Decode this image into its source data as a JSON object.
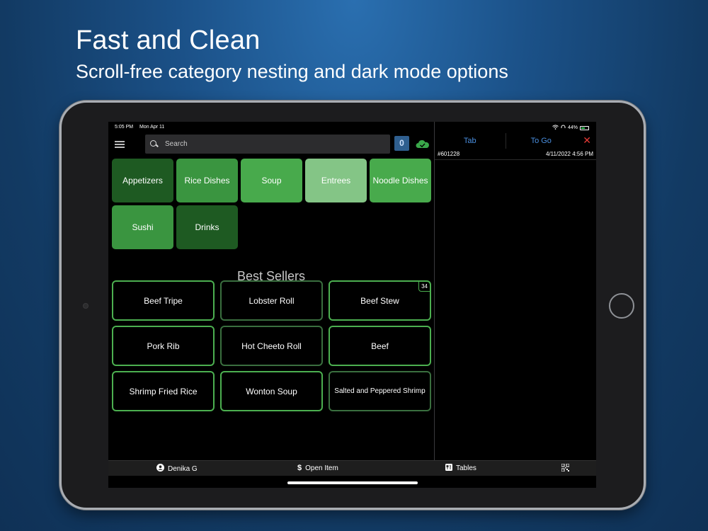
{
  "marketing": {
    "headline": "Fast and Clean",
    "subheadline": "Scroll-free category nesting and dark mode options"
  },
  "statusbar": {
    "time": "5:05 PM",
    "date": "Mon Apr 11",
    "battery": "44%"
  },
  "search": {
    "placeholder": "Search"
  },
  "cart_count": "0",
  "categories": [
    {
      "label": "Appetizers",
      "color": "#1e5a22"
    },
    {
      "label": "Rice Dishes",
      "color": "#3a9540"
    },
    {
      "label": "Soup",
      "color": "#48aa4c"
    },
    {
      "label": "Entrees",
      "color": "#84c586"
    },
    {
      "label": "Noodle Dishes",
      "color": "#48aa4c"
    },
    {
      "label": "Sushi",
      "color": "#3a9540"
    },
    {
      "label": "Drinks",
      "color": "#1e5a22"
    }
  ],
  "best_sellers": {
    "title": "Best Sellers",
    "items": [
      {
        "label": "Beef Tripe"
      },
      {
        "label": "Lobster Roll"
      },
      {
        "label": "Beef Stew",
        "badge": "34"
      },
      {
        "label": "Pork Rib"
      },
      {
        "label": "Hot Cheeto Roll"
      },
      {
        "label": "Beef"
      },
      {
        "label": "Shrimp Fried Rice"
      },
      {
        "label": "Wonton Soup"
      },
      {
        "label": "Salted and Peppered Shrimp"
      }
    ]
  },
  "order": {
    "tabs": [
      "Tab",
      "To Go"
    ],
    "close_symbol": "✕",
    "id": "#601228",
    "datetime": "4/11/2022 4:56 PM"
  },
  "bottombar": {
    "user": "Denika G",
    "open_item": "Open Item",
    "tables": "Tables"
  },
  "colors": {
    "accent_green": "#4caf50",
    "tab_blue": "#4a8fe0",
    "close_red": "#e53935"
  }
}
